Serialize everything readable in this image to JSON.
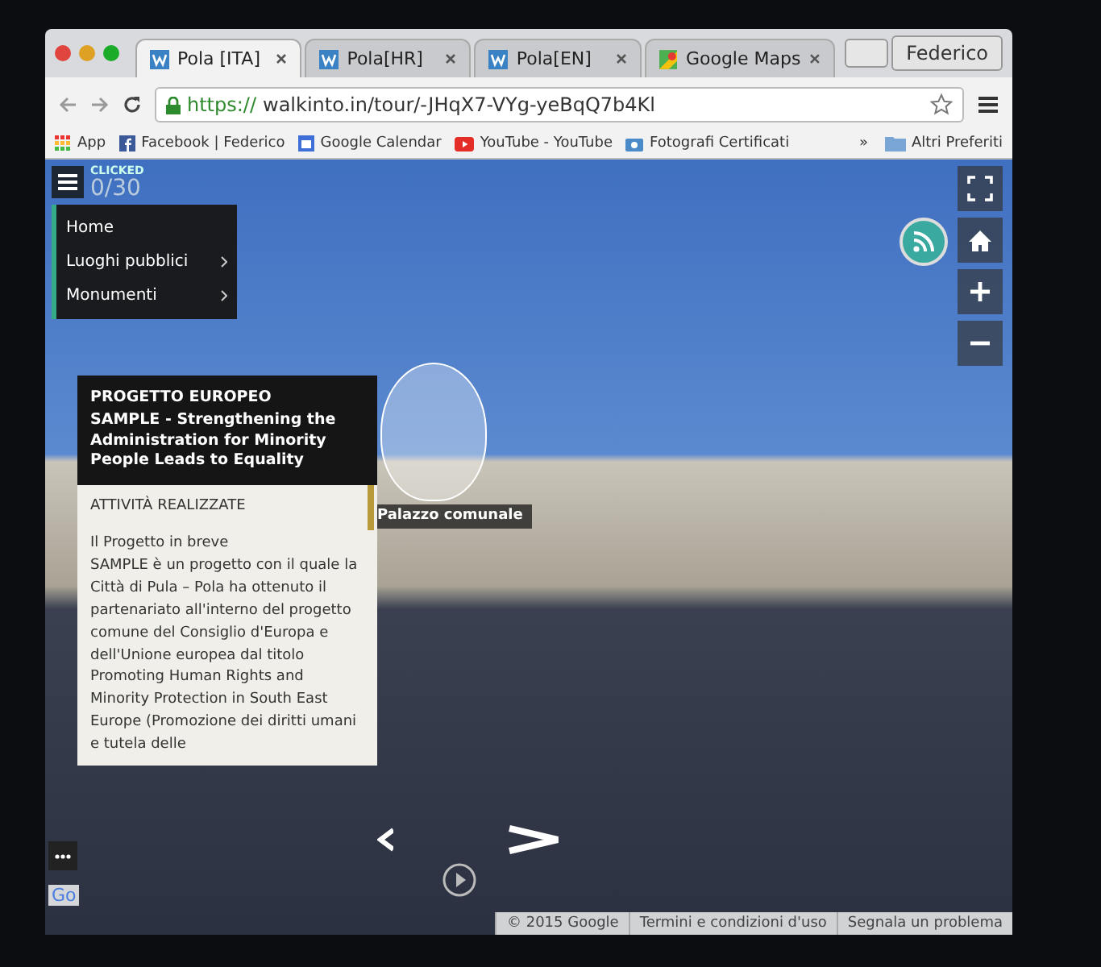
{
  "browser": {
    "tabs": [
      {
        "label": "Pola [ITA]",
        "kind": "site",
        "selected": true
      },
      {
        "label": "Pola[HR]",
        "kind": "site",
        "selected": false
      },
      {
        "label": "Pola[EN]",
        "kind": "site",
        "selected": false
      },
      {
        "label": "Google Maps",
        "kind": "maps",
        "selected": false
      }
    ],
    "profile": "Federico",
    "address_scheme": "https://",
    "address_rest": "walkinto.in/tour/-JHqX7-VYg-yeBqQ7b4Kl",
    "bookmarks": [
      {
        "label": "App",
        "kind": "apps"
      },
      {
        "label": "Facebook | Federico",
        "kind": "facebook"
      },
      {
        "label": "Google Calendar",
        "kind": "calendar"
      },
      {
        "label": "YouTube - YouTube",
        "kind": "youtube"
      },
      {
        "label": "Fotografi Certificati",
        "kind": "camera"
      }
    ],
    "more": "»",
    "other_bookmarks": "Altri Preferiti"
  },
  "tour": {
    "counter_label": "CLICKED",
    "counter": "0/30",
    "menu": [
      {
        "label": "Home",
        "has_submenu": false
      },
      {
        "label": "Luoghi pubblici",
        "has_submenu": true
      },
      {
        "label": "Monumenti",
        "has_submenu": true
      }
    ],
    "hotspot_label": "Palazzo comunale",
    "info": {
      "header": [
        "PROGETTO EUROPEO",
        "SAMPLE - Strengthening the Administration for Minority People Leads to Equality"
      ],
      "section": "ATTIVITÀ REALIZZATE",
      "subtitle": "Il Progetto in breve",
      "body": "SAMPLE è un progetto con il quale la Città di Pula – Pola ha ottenuto il partenariato all'interno del progetto comune del Consiglio d'Europa e dell'Unione europea dal titolo Promoting Human Rights and Minority Protection in South East Europe (Promozione dei diritti umani e tutela delle"
    },
    "logo": "Go",
    "footer": [
      "© 2015 Google",
      "Termini e condizioni d'uso",
      "Segnala un problema"
    ]
  }
}
